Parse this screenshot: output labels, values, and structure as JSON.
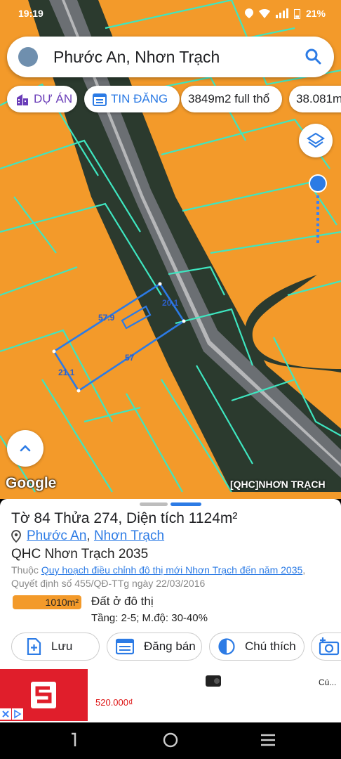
{
  "status_bar": {
    "time": "19:19",
    "battery": "21%"
  },
  "search": {
    "query": "Phước An, Nhơn Trạch"
  },
  "chips": [
    {
      "label": "DỰ ÁN",
      "icon": "building-icon",
      "color": "#6a3db8"
    },
    {
      "label": "TIN ĐĂNG",
      "icon": "calendar-list-icon",
      "color": "#2c7be5"
    },
    {
      "label": "3849m2 full thổ"
    },
    {
      "label": "38.081m"
    }
  ],
  "map": {
    "parcel_labels": {
      "top": "57.9",
      "right": "20.1",
      "bottom": "57",
      "left": "21.1"
    },
    "google_logo": "Google",
    "source": "[QHC]NHƠN TRẠCH",
    "colors": {
      "land": "#f39a2a",
      "parcel_lines": "#3ee6c0",
      "selected": "#2c7be5"
    }
  },
  "sheet": {
    "title": "Tờ 84 Thửa 274, Diện tích 1124m²",
    "location": {
      "ward": "Phước An",
      "separator": ", ",
      "district": "Nhơn Trạch"
    },
    "plan_name": "QHC Nhơn Trạch 2035",
    "desc_prefix": "Thuộc ",
    "desc_link": "Quy hoạch điều chỉnh đô thị mới Nhơn Trạch đến năm 2035",
    "desc_suffix": ", Quyết định số 455/QĐ-TTg ngày 22/03/2016",
    "area": "1010m²",
    "land_type": "Đất ở đô thị",
    "floors": "Tầng: 2-5; M.độ: 30-40%",
    "actions": {
      "save": "Lưu",
      "post": "Đăng bán",
      "legend": "Chú thích"
    }
  },
  "ad": {
    "price": "520.000₫",
    "title": "Cú..."
  }
}
